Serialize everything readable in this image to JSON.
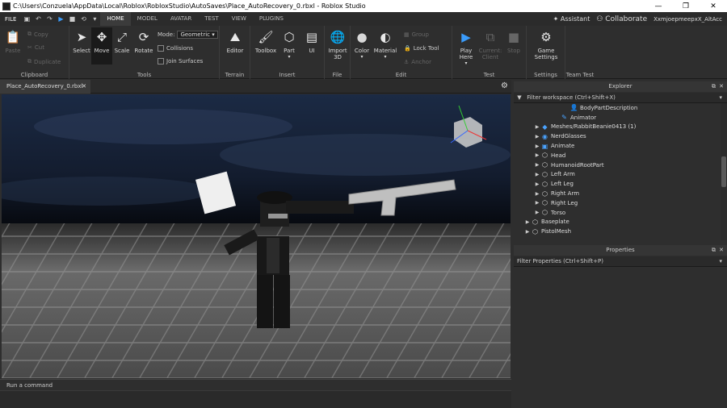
{
  "window": {
    "title": "C:\\Users\\Conzuela\\AppData\\Local\\Roblox\\RobloxStudio\\AutoSaves\\Place_AutoRecovery_0.rbxl - Roblox Studio",
    "min": "—",
    "max": "❐",
    "close": "✕"
  },
  "menu": {
    "file": "FILE",
    "tabs": [
      "HOME",
      "MODEL",
      "AVATAR",
      "TEST",
      "VIEW",
      "PLUGINS"
    ],
    "active_tab": "HOME",
    "assistant": "Assistant",
    "collaborate": "Collaborate",
    "user": "XxmjoepmeepxX_AltAcc"
  },
  "ribbon": {
    "clipboard": {
      "label": "Clipboard",
      "paste": "Paste",
      "copy": "Copy",
      "cut": "Cut",
      "duplicate": "Duplicate"
    },
    "tools": {
      "label": "Tools",
      "select": "Select",
      "move": "Move",
      "scale": "Scale",
      "rotate": "Rotate",
      "mode_label": "Mode:",
      "mode_value": "Geometric",
      "collisions": "Collisions",
      "join_surfaces": "Join Surfaces"
    },
    "terrain": {
      "label": "Terrain",
      "editor": "Editor"
    },
    "insert": {
      "label": "Insert",
      "toolbox": "Toolbox",
      "part": "Part",
      "ui": "UI"
    },
    "file": {
      "label": "File",
      "import3d": "Import 3D"
    },
    "edit": {
      "label": "Edit",
      "color": "Color",
      "material": "Material",
      "group": "Group",
      "lock_tool": "Lock Tool",
      "anchor": "Anchor"
    },
    "test": {
      "label": "Test",
      "play_here": "Play Here",
      "current_client": "Current: Client",
      "stop": "Stop"
    },
    "settings": {
      "label": "Settings",
      "game_settings": "Game Settings"
    },
    "team_test": {
      "label": "Team Test"
    }
  },
  "document": {
    "tab": "Place_AutoRecovery_0.rbxl"
  },
  "command": {
    "placeholder": "Run a command"
  },
  "explorer": {
    "title": "Explorer",
    "filter": "Filter workspace (Ctrl+Shift+X)",
    "items": [
      {
        "label": "BodyPartDescription",
        "indent": 5,
        "arrow": "",
        "icon": "body-part-icon"
      },
      {
        "label": "Animator",
        "indent": 4,
        "arrow": "",
        "icon": "animator-icon"
      },
      {
        "label": "Meshes/RabbitBeanie0413 (1)",
        "indent": 2,
        "arrow": "▶",
        "icon": "mesh-icon"
      },
      {
        "label": "NerdGlasses",
        "indent": 2,
        "arrow": "▶",
        "icon": "accessory-icon"
      },
      {
        "label": "Animate",
        "indent": 2,
        "arrow": "▶",
        "icon": "script-icon"
      },
      {
        "label": "Head",
        "indent": 2,
        "arrow": "▶",
        "icon": "part-icon"
      },
      {
        "label": "HumanoidRootPart",
        "indent": 2,
        "arrow": "▶",
        "icon": "part-icon"
      },
      {
        "label": "Left Arm",
        "indent": 2,
        "arrow": "▶",
        "icon": "part-icon"
      },
      {
        "label": "Left Leg",
        "indent": 2,
        "arrow": "▶",
        "icon": "part-icon"
      },
      {
        "label": "Right Arm",
        "indent": 2,
        "arrow": "▶",
        "icon": "part-icon"
      },
      {
        "label": "Right Leg",
        "indent": 2,
        "arrow": "▶",
        "icon": "part-icon"
      },
      {
        "label": "Torso",
        "indent": 2,
        "arrow": "▶",
        "icon": "part-icon"
      },
      {
        "label": "Baseplate",
        "indent": 1,
        "arrow": "▶",
        "icon": "part-icon"
      },
      {
        "label": "PistolMesh",
        "indent": 1,
        "arrow": "▶",
        "icon": "part-icon"
      }
    ]
  },
  "properties": {
    "title": "Properties",
    "filter": "Filter Properties (Ctrl+Shift+P)"
  },
  "colors": {
    "accent": "#3a9bfa",
    "panel": "#2e2e2e"
  }
}
